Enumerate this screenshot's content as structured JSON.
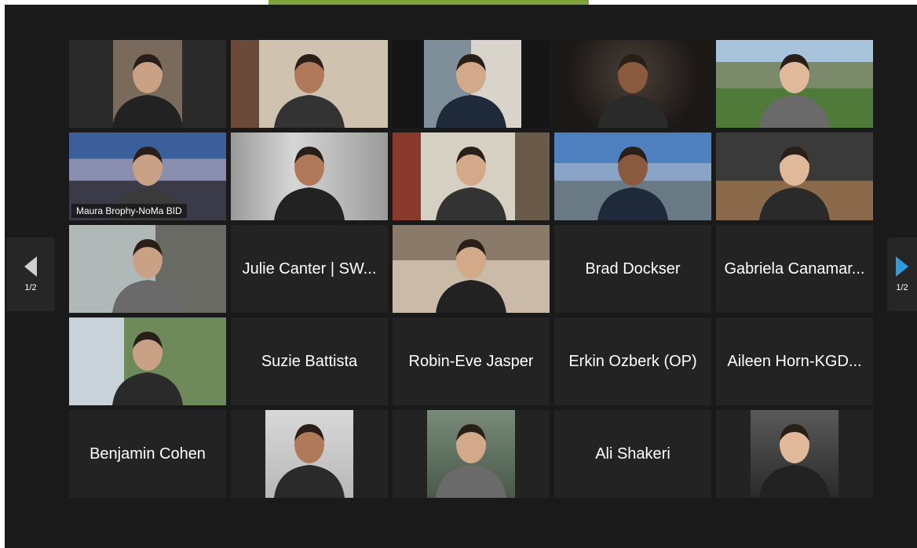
{
  "meeting": {
    "accent_color": "#7ea33a",
    "active_speaker_color": "#d8e67a",
    "page_indicator": "1/2",
    "prev_page_icon": "arrow-left-icon",
    "next_page_icon": "arrow-right-icon"
  },
  "tiles": [
    {
      "kind": "video",
      "scene": "warm room, older man"
    },
    {
      "kind": "video",
      "scene": "office with shelves"
    },
    {
      "kind": "video",
      "scene": "office window"
    },
    {
      "kind": "video",
      "scene": "dark background"
    },
    {
      "kind": "video",
      "scene": "mountain landscape"
    },
    {
      "kind": "video",
      "scene": "city skyline night",
      "label": "Maura Brophy-NoMa BID",
      "active": true
    },
    {
      "kind": "video",
      "scene": "blurred office"
    },
    {
      "kind": "video",
      "scene": "office with paintings"
    },
    {
      "kind": "video",
      "scene": "river city sunset"
    },
    {
      "kind": "video",
      "scene": "planning & development office"
    },
    {
      "kind": "video",
      "scene": "open office"
    },
    {
      "kind": "name",
      "name": "Julie Canter | SW..."
    },
    {
      "kind": "video",
      "scene": "loft with brick"
    },
    {
      "kind": "name",
      "name": "Brad Dockser"
    },
    {
      "kind": "name",
      "name": "Gabriela Canamar..."
    },
    {
      "kind": "video",
      "scene": "street with trees"
    },
    {
      "kind": "name",
      "name": "Suzie Battista"
    },
    {
      "kind": "name",
      "name": "Robin-Eve Jasper"
    },
    {
      "kind": "name",
      "name": "Erkin Ozberk (OP)"
    },
    {
      "kind": "name",
      "name": "Aileen Horn-KGD..."
    },
    {
      "kind": "name",
      "name": "Benjamin Cohen"
    },
    {
      "kind": "photo",
      "scene": "profile photo woman"
    },
    {
      "kind": "photo",
      "scene": "profile photo woman blonde"
    },
    {
      "kind": "name",
      "name": "Ali Shakeri"
    },
    {
      "kind": "photo",
      "scene": "profile photo man suit"
    }
  ]
}
